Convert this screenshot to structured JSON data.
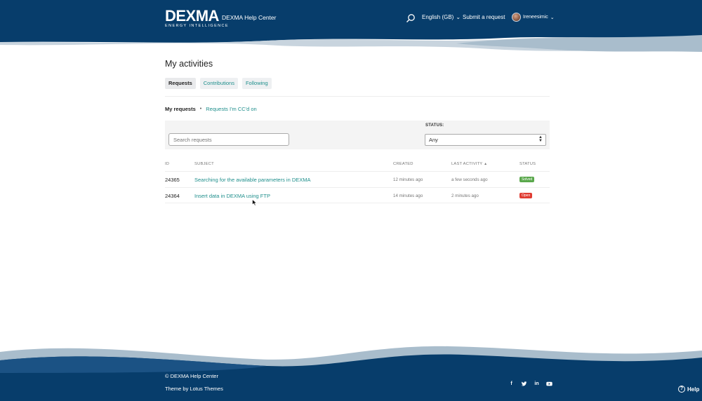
{
  "colors": {
    "navy": "#073d6b",
    "teal_link": "#1f8f8c",
    "solved": "#5aa84c",
    "open": "#e03c32"
  },
  "header": {
    "logo_main": "DEXMA",
    "logo_sub": "ENERGY INTELLIGENCE",
    "brand_title": "DEXMA Help Center",
    "language": "English (GB)",
    "submit_request": "Submit a request",
    "username": "Ireneesimic"
  },
  "page": {
    "title": "My activities"
  },
  "tabs": [
    {
      "label": "Requests",
      "active": true
    },
    {
      "label": "Contributions",
      "active": false
    },
    {
      "label": "Following",
      "active": false
    }
  ],
  "subnav": {
    "current": "My requests",
    "other": "Requests I'm CC'd on"
  },
  "filters": {
    "search_placeholder": "Search requests",
    "status_label": "STATUS:",
    "status_value": "Any"
  },
  "table": {
    "headers": {
      "id": "ID",
      "subject": "SUBJECT",
      "created": "CREATED",
      "last_activity": "LAST ACTIVITY",
      "status": "STATUS"
    },
    "rows": [
      {
        "id": "24365",
        "subject": "Searching for the available parameters in DEXMA",
        "created": "12 minutes ago",
        "last_activity": "a few seconds ago",
        "status": "Solved"
      },
      {
        "id": "24364",
        "subject": "Insert data in DEXMA using FTP",
        "created": "14 minutes ago",
        "last_activity": "2 minutes ago",
        "status": "Open"
      }
    ]
  },
  "footer": {
    "copyright": "© DEXMA Help Center",
    "theme": "Theme by Lotus Themes",
    "social_icons": [
      "facebook-icon",
      "twitter-icon",
      "linkedin-icon",
      "youtube-icon"
    ],
    "help_label": "Help"
  }
}
